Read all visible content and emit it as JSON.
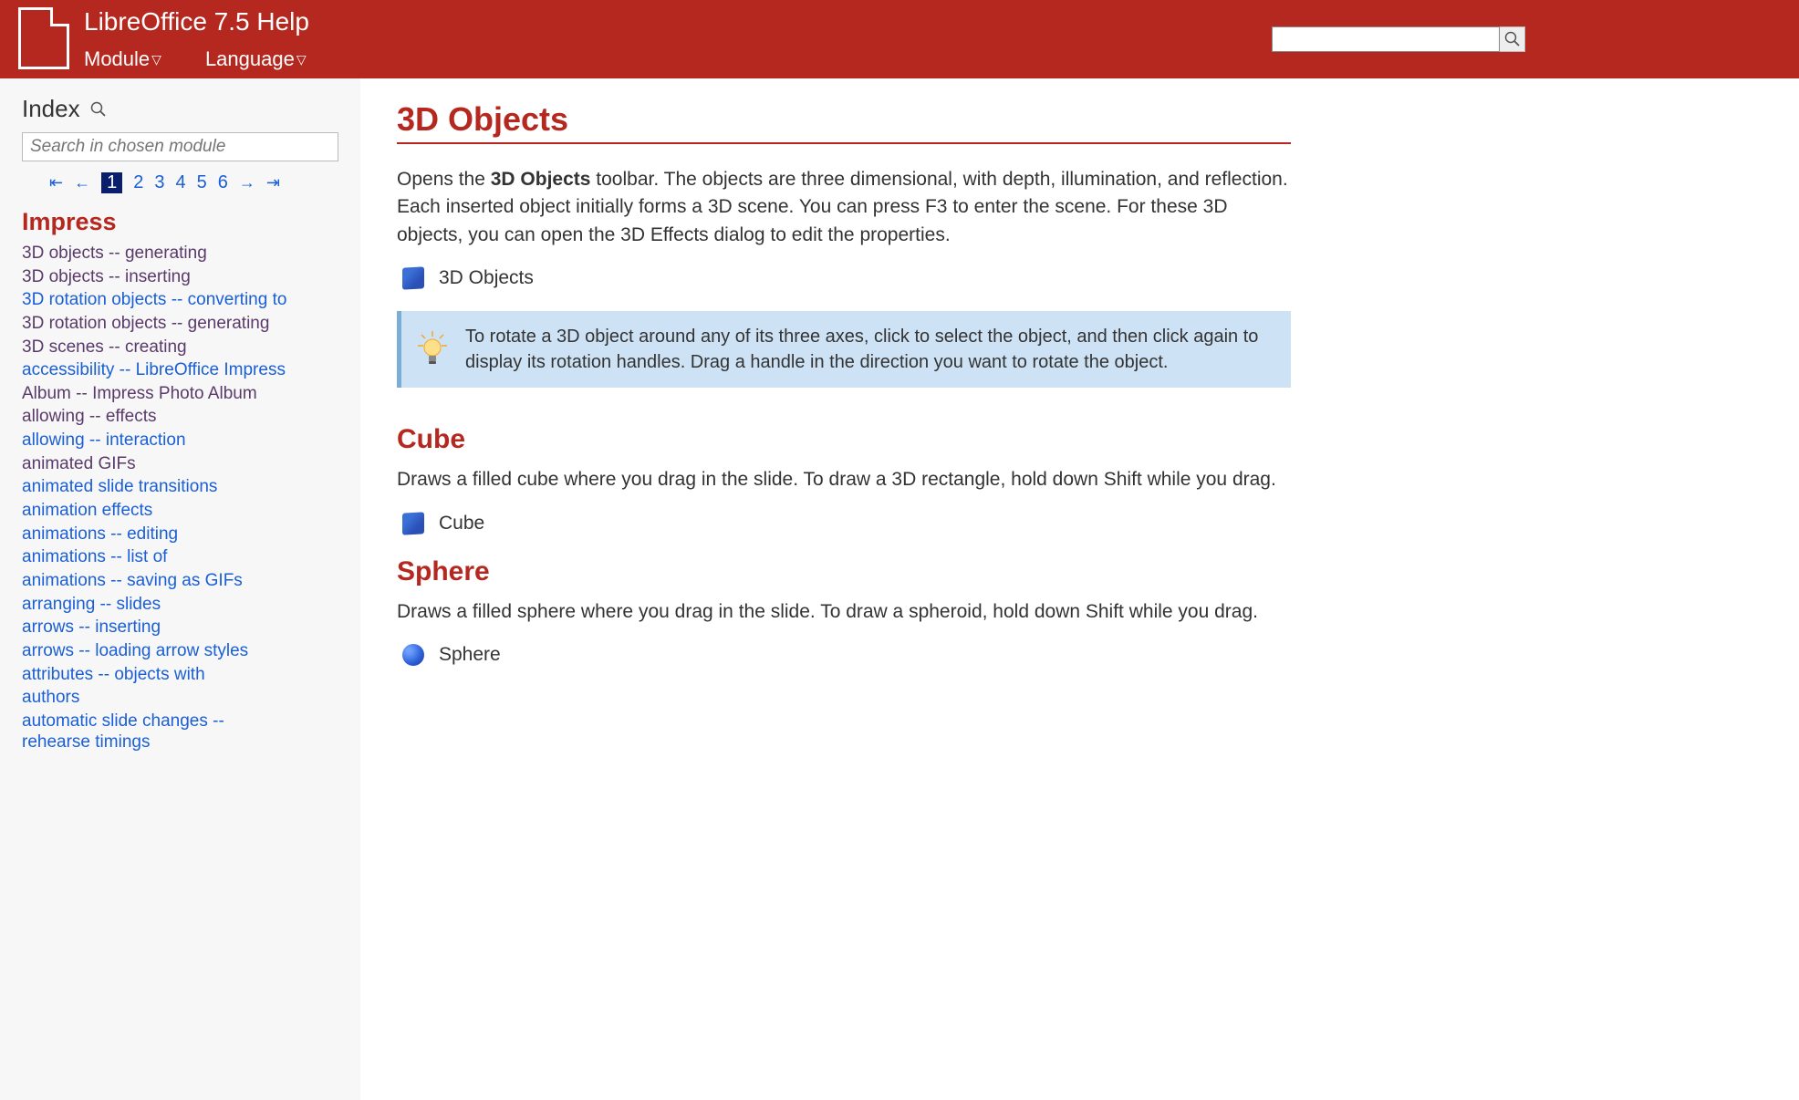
{
  "header": {
    "title": "LibreOffice 7.5 Help",
    "menus": {
      "module": "Module",
      "language": "Language"
    },
    "search_placeholder": ""
  },
  "sidebar": {
    "heading": "Index",
    "search_placeholder": "Search in chosen module",
    "pagination": {
      "first": "⇤",
      "prev": "←",
      "pages": [
        "1",
        "2",
        "3",
        "4",
        "5",
        "6"
      ],
      "current": "1",
      "next": "→",
      "last": "⇥"
    },
    "section": "Impress",
    "items": [
      {
        "text": "3D objects -- generating",
        "style": "visited"
      },
      {
        "text": "3D objects -- inserting",
        "style": "visited"
      },
      {
        "text": "3D rotation objects -- converting to",
        "style": "blue"
      },
      {
        "text": "3D rotation objects -- generating",
        "style": "visited"
      },
      {
        "text": "3D scenes -- creating",
        "style": "visited"
      },
      {
        "text": "accessibility -- LibreOffice Impress",
        "style": "blue"
      },
      {
        "text": "Album -- Impress Photo Album",
        "style": "visited"
      },
      {
        "text": "allowing -- effects",
        "style": "visited"
      },
      {
        "text": "allowing -- interaction",
        "style": "blue"
      },
      {
        "text": "animated GIFs",
        "style": "visited"
      },
      {
        "text": "animated slide transitions",
        "style": "blue"
      },
      {
        "text": "animation effects",
        "style": "blue"
      },
      {
        "text": "animations -- editing",
        "style": "blue"
      },
      {
        "text": "animations -- list of",
        "style": "blue"
      },
      {
        "text": "animations -- saving as GIFs",
        "style": "blue"
      },
      {
        "text": "arranging -- slides",
        "style": "blue"
      },
      {
        "text": "arrows -- inserting",
        "style": "blue"
      },
      {
        "text": "arrows -- loading arrow styles",
        "style": "blue"
      },
      {
        "text": "attributes -- objects with",
        "style": "blue"
      },
      {
        "text": "authors",
        "style": "blue"
      },
      {
        "text": "automatic slide changes --",
        "style": "blue"
      },
      {
        "text": "rehearse timings",
        "style": "blue",
        "continuation": true
      }
    ]
  },
  "main": {
    "title": "3D Objects",
    "intro_pre": "Opens the ",
    "intro_bold": "3D Objects",
    "intro_post": " toolbar. The objects are three dimensional, with depth, illumination, and reflection. Each inserted object initially forms a 3D scene. You can press F3 to enter the scene. For these 3D objects, you can open the 3D Effects dialog to edit the properties.",
    "object_label": "3D Objects",
    "tip": "To rotate a 3D object around any of its three axes, click to select the object, and then click again to display its rotation handles. Drag a handle in the direction you want to rotate the object.",
    "cube": {
      "heading": "Cube",
      "text": "Draws a filled cube where you drag in the slide. To draw a 3D rectangle, hold down Shift while you drag.",
      "label": "Cube"
    },
    "sphere": {
      "heading": "Sphere",
      "text": "Draws a filled sphere where you drag in the slide. To draw a spheroid, hold down Shift while you drag.",
      "label": "Sphere"
    }
  }
}
